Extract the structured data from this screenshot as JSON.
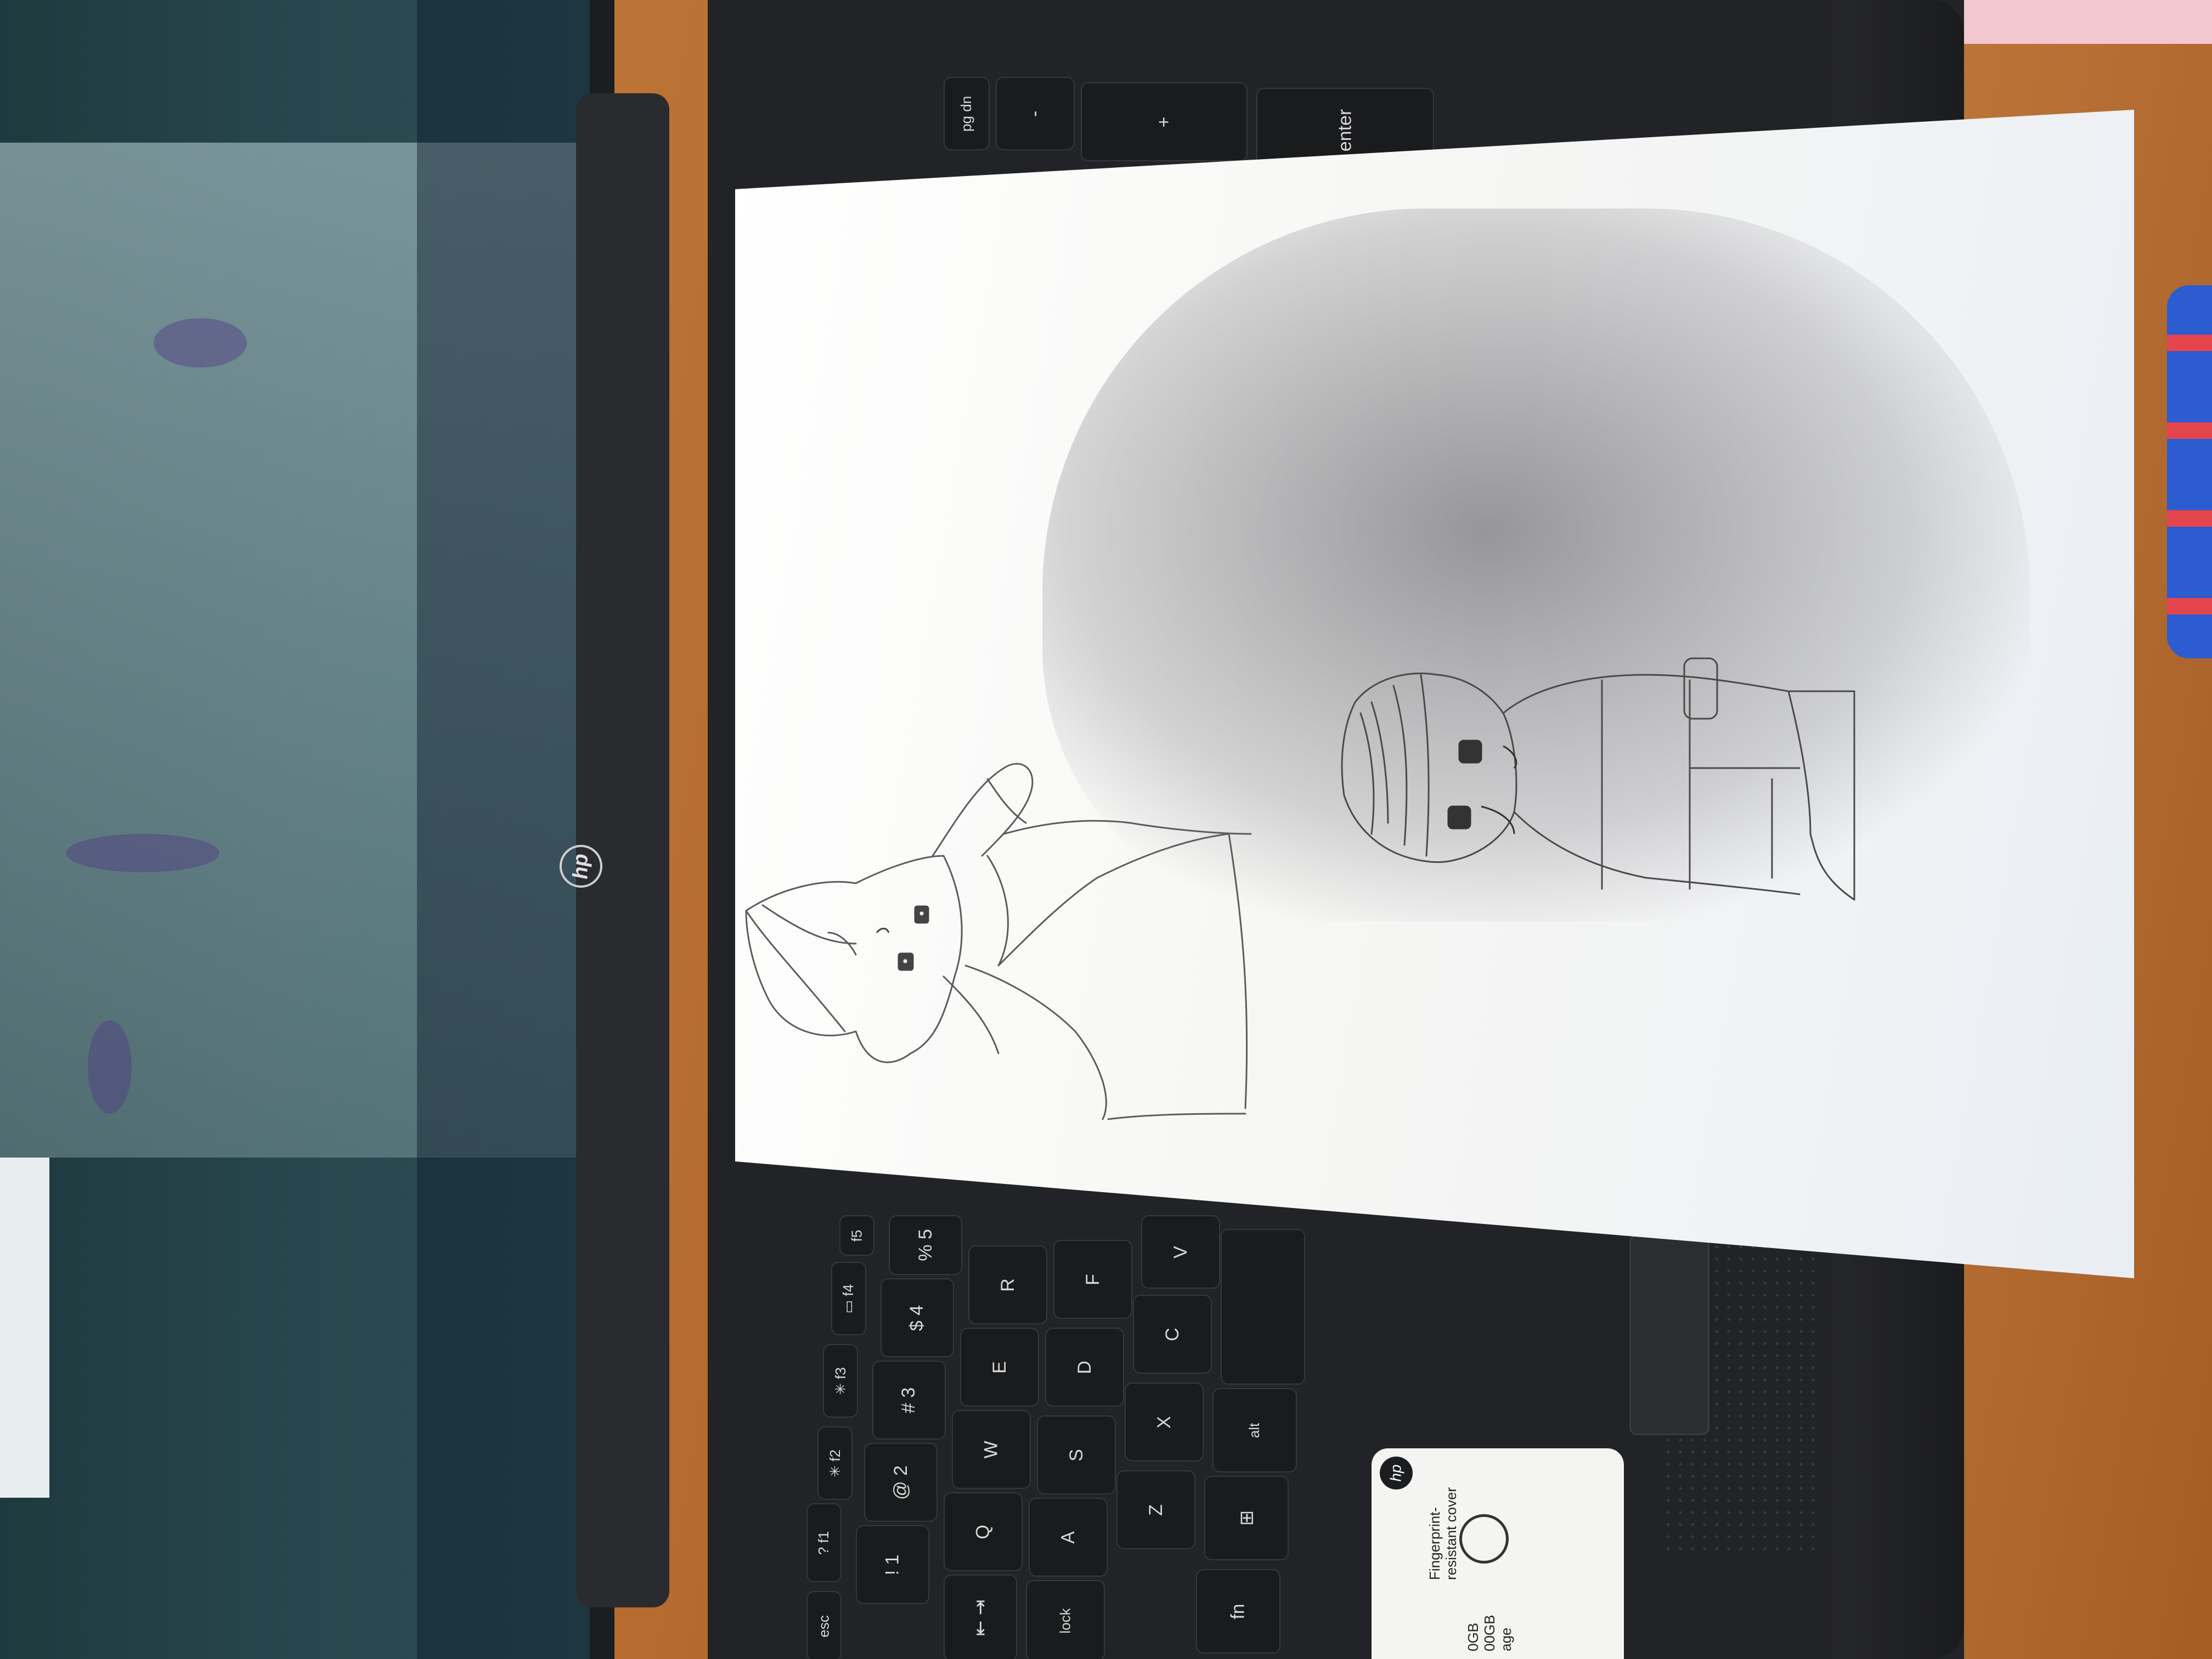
{
  "keyboard": {
    "keys": [
      {
        "id": "pg-dn",
        "label": "pg dn"
      },
      {
        "id": "minus",
        "label": "-"
      },
      {
        "id": "plus",
        "label": "+"
      },
      {
        "id": "enter",
        "label": "enter"
      },
      {
        "id": "esc",
        "label": "esc"
      },
      {
        "id": "f1",
        "label": "? f1"
      },
      {
        "id": "f2",
        "label": "✳ f2"
      },
      {
        "id": "f3",
        "label": "✳ f3"
      },
      {
        "id": "f4",
        "label": "▭ f4"
      },
      {
        "id": "f5",
        "label": "f5"
      },
      {
        "id": "num1",
        "label": "! 1"
      },
      {
        "id": "num2",
        "label": "@ 2"
      },
      {
        "id": "num3",
        "label": "# 3"
      },
      {
        "id": "num4",
        "label": "$ 4"
      },
      {
        "id": "num5",
        "label": "% 5"
      },
      {
        "id": "tab",
        "label": "⇤ ⇥"
      },
      {
        "id": "q",
        "label": "Q"
      },
      {
        "id": "w",
        "label": "W"
      },
      {
        "id": "e",
        "label": "E"
      },
      {
        "id": "r",
        "label": "R"
      },
      {
        "id": "caps",
        "label": "lock"
      },
      {
        "id": "a",
        "label": "A"
      },
      {
        "id": "s",
        "label": "S"
      },
      {
        "id": "d",
        "label": "D"
      },
      {
        "id": "f",
        "label": "F"
      },
      {
        "id": "z",
        "label": "Z"
      },
      {
        "id": "x",
        "label": "X"
      },
      {
        "id": "c",
        "label": "C"
      },
      {
        "id": "v",
        "label": "V"
      },
      {
        "id": "fn",
        "label": "fn"
      },
      {
        "id": "win",
        "label": "⊞"
      },
      {
        "id": "alt",
        "label": "alt"
      }
    ]
  },
  "branding": {
    "lid_logo": "hp",
    "sticker_logo": "hp",
    "sticker_text_1": "Fingerprint-",
    "sticker_text_2": "resistant cover",
    "sticker_text_3": "0GB",
    "sticker_text_4": "00GB",
    "sticker_text_5": "age"
  },
  "colors": {
    "desk": "#b86a2e",
    "laptop": "#222326",
    "paper": "#f6f6f4",
    "pencil": "#555555"
  }
}
